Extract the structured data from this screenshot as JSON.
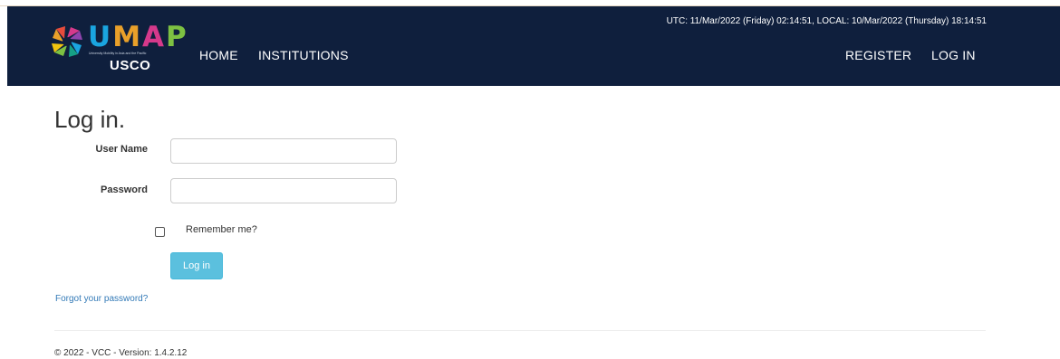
{
  "brand": {
    "logo_letters": [
      "U",
      "M",
      "A",
      "P"
    ],
    "logo_colors": [
      "#1aa5e0",
      "#e9a02a",
      "#d5398b",
      "#7dc142"
    ],
    "logo_tagline": "University Mobility in Asia and the Pacific",
    "logo_sub": "USCO"
  },
  "nav": {
    "home": "HOME",
    "institutions": "INSTITUTIONS",
    "register": "REGISTER",
    "login": "LOG IN"
  },
  "clock": "UTC: 11/Mar/2022 (Friday) 02:14:51, LOCAL: 10/Mar/2022 (Thursday) 18:14:51",
  "page": {
    "title": "Log in.",
    "username_label": "User Name",
    "password_label": "Password",
    "username_value": "",
    "password_value": "",
    "remember_label": "Remember me?",
    "remember_checked": false,
    "submit_label": "Log in",
    "forgot_link": "Forgot your password?"
  },
  "footer": "© 2022 - VCC - Version: 1.4.2.12",
  "colors": {
    "navbar": "#0f1f3d",
    "button": "#5bc0de",
    "link": "#337ab7"
  }
}
